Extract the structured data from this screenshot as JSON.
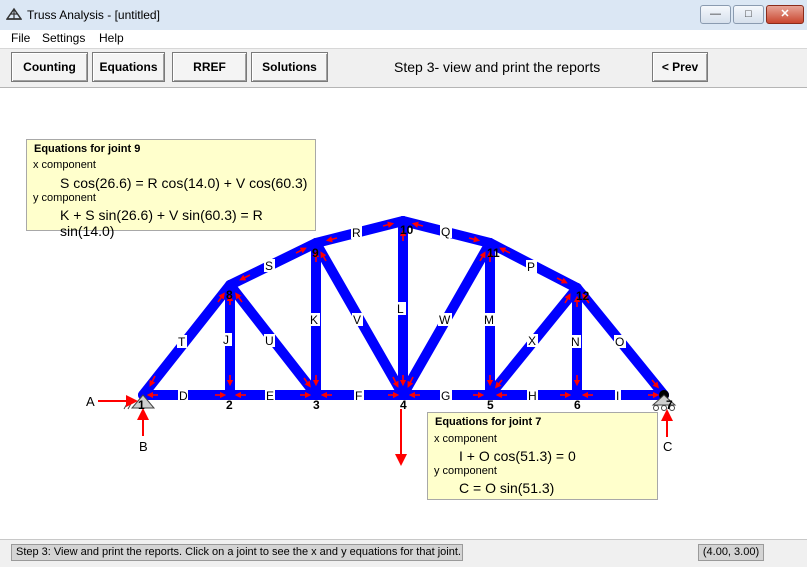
{
  "window": {
    "title": "Truss Analysis - [untitled]",
    "min": "—",
    "max": "□",
    "close": "✕"
  },
  "menu": {
    "file": "File",
    "settings": "Settings",
    "help": "Help"
  },
  "toolbar": {
    "counting": "Counting",
    "equations": "Equations",
    "rref": "RREF",
    "solutions": "Solutions",
    "step": "Step 3- view and print the reports",
    "prev": "< Prev"
  },
  "eq9": {
    "title": "Equations for joint 9",
    "xlabel": "x component",
    "xeq": "S cos(26.6) = R cos(14.0) + V cos(60.3)",
    "ylabel": "y component",
    "yeq": "K + S sin(26.6) + V sin(60.3) = R sin(14.0)"
  },
  "eq7": {
    "title": "Equations for joint 7",
    "xlabel": "x component",
    "xeq": "I + O cos(51.3) = 0",
    "ylabel": "y component",
    "yeq": "C = O sin(51.3)"
  },
  "joints": {
    "j1": "1",
    "j2": "2",
    "j3": "3",
    "j4": "4",
    "j5": "5",
    "j6": "6",
    "j7": "7",
    "j8": "8",
    "j9": "9",
    "j10": "10",
    "j11": "11",
    "j12": "12"
  },
  "members": {
    "D": "D",
    "E": "E",
    "F": "F",
    "G": "G",
    "H": "H",
    "I": "I",
    "J": "J",
    "K": "K",
    "L": "L",
    "M": "M",
    "N": "N",
    "O": "O",
    "P": "P",
    "Q": "Q",
    "R": "R",
    "S": "S",
    "T": "T",
    "U": "U",
    "V": "V",
    "W": "W",
    "X": "X"
  },
  "forces": {
    "A": "A",
    "B": "B",
    "C": "C"
  },
  "status": {
    "message": "Step 3: View and print the reports.  Click on a joint to see the x and y equations for that joint.",
    "coords": "(4.00, 3.00)"
  },
  "colors": {
    "member": "#0000ff",
    "arrow": "#ff0000",
    "eqbox": "#ffffcc"
  }
}
